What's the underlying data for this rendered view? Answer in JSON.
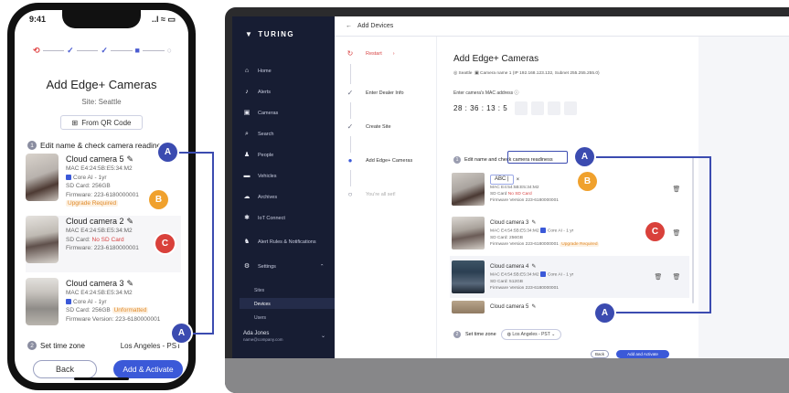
{
  "mobile": {
    "status_time": "9:41",
    "status_icons": "..l ≈ ▭",
    "title": "Add Edge+ Cameras",
    "site": "Site: Seattle",
    "scan_qr": "From QR Code",
    "section1": "Edit name & check camera readiness",
    "cameras": [
      {
        "name": "Cloud camera 5",
        "mac": "MAC E4:24:5B:E5:34:M2",
        "plan": "Core AI - 1yr",
        "sd": "SD Card: 256GB",
        "firmware": "Firmware: 223-6180000001",
        "warning": "Upgrade Required"
      },
      {
        "name": "Cloud camera 2",
        "mac": "MAC E4:24:5B:E5:34:M2",
        "plan": "",
        "sd": "SD Card:",
        "firmware": "Firmware: 223-6180000001",
        "warning": "No SD Card"
      },
      {
        "name": "Cloud camera 3",
        "mac": "MAC E4:24:5B:E5:34:M2",
        "plan": "Core AI - 1yr",
        "sd": "SD Card: 256GB",
        "firmware": "Firmware Version: 223-6180000001",
        "warning": "Unformatted"
      }
    ],
    "section2": "Set time zone",
    "timezone": "Los Angeles - PST",
    "back": "Back",
    "activate": "Add & Activate"
  },
  "desktop": {
    "logo": "TURING",
    "nav": [
      {
        "label": "Home",
        "icon": "home-icon",
        "glyph": "⌂"
      },
      {
        "label": "Alerts",
        "icon": "bell-icon",
        "glyph": "♪"
      },
      {
        "label": "Cameras",
        "icon": "camera-icon",
        "glyph": "▣"
      },
      {
        "label": "Search",
        "icon": "search-icon",
        "glyph": "⌕"
      },
      {
        "label": "People",
        "icon": "person-icon",
        "glyph": "♟"
      },
      {
        "label": "Vehicles",
        "icon": "vehicle-icon",
        "glyph": "▬"
      },
      {
        "label": "Archives",
        "icon": "cloud-icon",
        "glyph": "☁"
      },
      {
        "label": "IoT Connect",
        "icon": "iot-icon",
        "glyph": "✱"
      },
      {
        "label": "Alert Rules & Notifications",
        "icon": "rules-icon",
        "glyph": "♞"
      },
      {
        "label": "Settings",
        "icon": "gear-icon",
        "glyph": "⚙"
      }
    ],
    "settings_sub": [
      "Sites",
      "Devices",
      "Users"
    ],
    "user_name": "Ada Jones",
    "user_email": "name@company.com",
    "breadcrumb": "Add Devices",
    "steps": [
      {
        "label": "Restart",
        "mark": "↻"
      },
      {
        "label": "Enter Dealer Info",
        "mark": "✓"
      },
      {
        "label": "Create Site",
        "mark": "✓"
      },
      {
        "label": "Add Edge+ Cameras",
        "mark": "●"
      },
      {
        "label": "You're all set!",
        "mark": "○"
      }
    ],
    "title": "Add Edge+ Cameras",
    "location": "Seattle",
    "camera_ref": "Camera name 1 (IP 192.168.123.132, Subnet 255.255.255.0)",
    "mac_label": "Enter camera's MAC address",
    "mac_value": "28 : 36 : 13 : 5",
    "section1": "Edit name and check camera readiness",
    "cameras": [
      {
        "name": "ABC |",
        "mac": "MAC E4:54:5B:E5:34:M2",
        "sd": "SD Card",
        "sd_warning": "No SD Card",
        "firmware": "Firmware Version 223-6180000001",
        "plan": "",
        "warning": ""
      },
      {
        "name": "Cloud camera 3",
        "mac": "MAC E4:54:5B:E5:34:M2",
        "sd": "SD Card: 256GB",
        "sd_warning": "",
        "firmware": "Firmware Version 223-6180000001",
        "plan": "Core AI - 1 yr",
        "warning": "Upgrade Required"
      },
      {
        "name": "Cloud camera 4",
        "mac": "MAC E4:54:5B:E5:34:M2",
        "sd": "SD Card: 512GB",
        "sd_warning": "",
        "firmware": "Firmware Version 223-6180000001",
        "plan": "Core AI - 1 yr",
        "warning": ""
      },
      {
        "name": "Cloud camera 5",
        "mac": "",
        "sd": "",
        "sd_warning": "",
        "firmware": "",
        "plan": "",
        "warning": ""
      }
    ],
    "section2": "Set time zone",
    "timezone": "Los Angeles - PST",
    "back": "Back",
    "activate": "Add and Activate"
  },
  "annotations": {
    "a": "A",
    "b": "B",
    "c": "C"
  },
  "colors": {
    "accent": "#3b59d8",
    "sidebar": "#171d33",
    "annotation_blue": "#3b4bb0",
    "annotation_orange": "#f0a12d",
    "annotation_red": "#d9413b"
  }
}
